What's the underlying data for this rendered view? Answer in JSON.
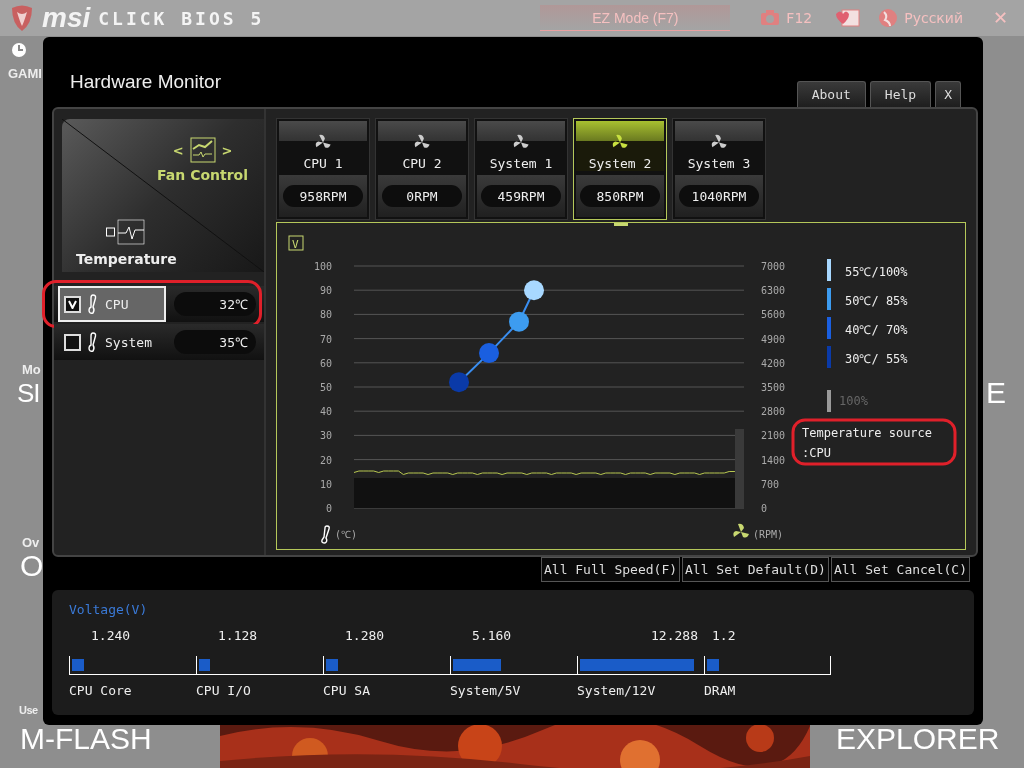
{
  "header": {
    "brand": "msi",
    "product": "CLICK BIOS 5",
    "mode_button": "EZ Mode (F7)",
    "screenshot_key": "F12",
    "language": "Русский",
    "close": "✕"
  },
  "background_tiles": [
    {
      "kind": "small",
      "text": "GAMI"
    },
    {
      "kind": "small",
      "text": "Mo"
    },
    {
      "kind": "large",
      "text": "SI"
    },
    {
      "kind": "small",
      "text": "Ov"
    },
    {
      "kind": "large",
      "text": "O"
    },
    {
      "kind": "small",
      "text": "Use"
    },
    {
      "kind": "large",
      "text": "M-FLASH"
    },
    {
      "kind": "large",
      "text": "E"
    },
    {
      "kind": "large",
      "text": "EXPLORER"
    }
  ],
  "dialog": {
    "title": "Hardware Monitor",
    "tabs": [
      {
        "label": "About"
      },
      {
        "label": "Help"
      },
      {
        "label": "X"
      }
    ],
    "sidebar": {
      "fan_control": {
        "label": "Fan Control",
        "arrow_left": "<",
        "arrow_right": ">"
      },
      "temperature": {
        "label": "Temperature"
      },
      "sensors": [
        {
          "name": "CPU",
          "value": "32℃",
          "checked": true,
          "selected": true,
          "highlighted": true
        },
        {
          "name": "System",
          "value": "35℃",
          "checked": false,
          "selected": false,
          "highlighted": false
        }
      ]
    },
    "fans": [
      {
        "name": "CPU 1",
        "rpm": "958RPM",
        "selected": false
      },
      {
        "name": "CPU 2",
        "rpm": "0RPM",
        "selected": false
      },
      {
        "name": "System 1",
        "rpm": "459RPM",
        "selected": false
      },
      {
        "name": "System 2",
        "rpm": "850RPM",
        "selected": true
      },
      {
        "name": "System 3",
        "rpm": "1040RPM",
        "selected": false
      }
    ],
    "fan_curve": {
      "enable_box": "V",
      "checked": true,
      "temp_ticks": [
        "100",
        "90",
        "80",
        "70",
        "60",
        "50",
        "40",
        "30",
        "20",
        "10",
        "0"
      ],
      "rpm_ticks": [
        "7000",
        "6300",
        "5600",
        "4900",
        "4200",
        "3500",
        "2800",
        "2100",
        "1400",
        "700",
        "0"
      ],
      "temp_unit": "(℃)",
      "rpm_unit": "(RPM)",
      "legend": [
        {
          "label": "55℃/100%",
          "color": "#a8d8ff",
          "dimmed": false
        },
        {
          "label": "50℃/ 85%",
          "color": "#3d9cf0",
          "dimmed": false
        },
        {
          "label": "40℃/ 70%",
          "color": "#1a5fe0",
          "dimmed": false
        },
        {
          "label": "30℃/ 55%",
          "color": "#0a3aa8",
          "dimmed": false
        },
        {
          "label": "100%",
          "color": "#9a9a9a",
          "dimmed": true
        }
      ],
      "source_lines": [
        "Temperature source",
        ":CPU"
      ],
      "source_highlighted": true
    },
    "buttons": [
      "All Full Speed(F)",
      "All Set Default(D)",
      "All Set Cancel(C)"
    ],
    "voltage": {
      "title": "Voltage(V)",
      "items": [
        {
          "name": "CPU Core",
          "value": "1.240",
          "level": 0.1
        },
        {
          "name": "CPU I/O",
          "value": "1.128",
          "level": 0.09
        },
        {
          "name": "CPU SA",
          "value": "1.280",
          "level": 0.1
        },
        {
          "name": "System/5V",
          "value": "5.160",
          "level": 0.4
        },
        {
          "name": "System/12V",
          "value": "12.288",
          "level": 0.95
        },
        {
          "name": "DRAM",
          "value": "1.2",
          "level": 0.1
        }
      ]
    }
  }
}
